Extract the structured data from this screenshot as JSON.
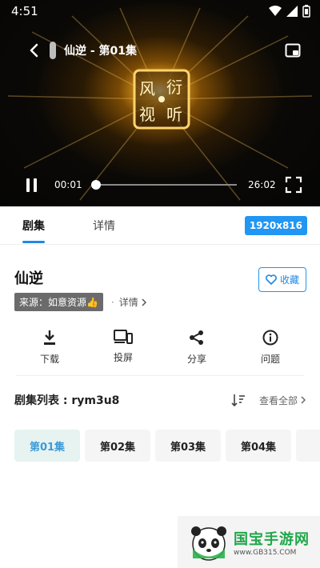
{
  "status_bar": {
    "time": "4:51"
  },
  "player": {
    "title": "仙逆 - 第01集",
    "logo_text": [
      "风",
      "衍",
      "视",
      "听"
    ],
    "current_time": "00:01",
    "total_time": "26:02",
    "progress_fraction": 0.01
  },
  "tabs": [
    {
      "label": "剧集",
      "active": true
    },
    {
      "label": "详情",
      "active": false
    }
  ],
  "resolution": "1920x816",
  "show": {
    "title": "仙逆",
    "source_label": "来源：如意资源👍",
    "details_link": "详情",
    "favorite_label": "收藏"
  },
  "actions": [
    {
      "label": "下载",
      "icon": "download-icon"
    },
    {
      "label": "投屏",
      "icon": "cast-icon"
    },
    {
      "label": "分享",
      "icon": "share-icon"
    },
    {
      "label": "问题",
      "icon": "info-icon"
    }
  ],
  "episodes": {
    "header": "剧集列表 : rym3u8",
    "view_all": "查看全部",
    "items": [
      "第01集",
      "第02集",
      "第03集",
      "第04集"
    ],
    "active_index": 0
  },
  "watermark": {
    "brand": "国宝手游网",
    "url": "www.GB315.COM"
  },
  "colors": {
    "accent": "#1e88e5",
    "badge": "#2196f3",
    "active_chip_bg": "#e6f3f1"
  }
}
